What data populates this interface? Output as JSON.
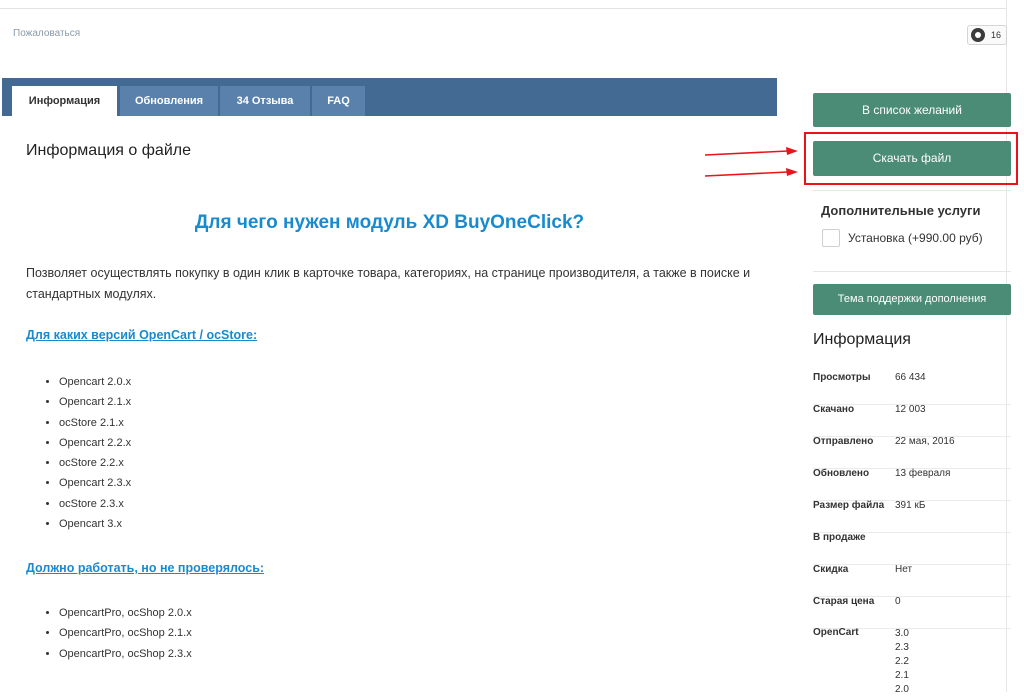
{
  "header": {
    "report": "Пожаловаться",
    "reaction_count": "16"
  },
  "tabs": [
    {
      "label": "Информация"
    },
    {
      "label": "Обновления"
    },
    {
      "label": "34 Отзыва"
    },
    {
      "label": "FAQ"
    }
  ],
  "content": {
    "section_title": "Информация о файле",
    "heading": "Для чего нужен модуль XD BuyOneClick?",
    "description": "Позволяет осуществлять покупку в один клик в карточке товара, категориях, на странице производителя, а также в поиске и стандартных модулях.",
    "versions_link": "Для каких версий OpenCart / ocStore:",
    "versions": [
      "Opencart 2.0.x",
      "Opencart 2.1.x",
      "ocStore 2.1.x",
      "Opencart 2.2.x",
      "ocStore 2.2.x",
      "Opencart 2.3.x",
      "ocStore 2.3.x",
      "Opencart 3.x"
    ],
    "untested_link": "Должно работать, но не проверялось:",
    "untested": [
      "OpencartPro, ocShop 2.0.x",
      "OpencartPro, ocShop 2.1.x",
      "OpencartPro, ocShop 2.3.x"
    ]
  },
  "sidebar": {
    "wishlist_button": "В список желаний",
    "download_button": "Скачать файл",
    "addons_title": "Дополнительные услуги",
    "install_option": "Установка (+990.00 руб)",
    "support_button": "Тема поддержки дополнения",
    "info_title": "Информация",
    "info": [
      {
        "key": "Просмотры",
        "value": "66 434"
      },
      {
        "key": "Скачано",
        "value": "12 003"
      },
      {
        "key": "Отправлено",
        "value": "22 мая, 2016"
      },
      {
        "key": "Обновлено",
        "value": "13 февраля"
      },
      {
        "key": "Размер файла",
        "value": "391 кБ"
      },
      {
        "key": "В продаже",
        "value": ""
      },
      {
        "key": "Скидка",
        "value": "Нет"
      },
      {
        "key": "Старая цена",
        "value": "0"
      },
      {
        "key": "OpenCart",
        "values": [
          "3.0",
          "2.3",
          "2.2",
          "2.1",
          "2.0"
        ]
      }
    ]
  },
  "colors": {
    "accent": "#1a8ace",
    "tabbar": "#436a93",
    "button": "#4a8c75",
    "highlight": "#e8141a"
  }
}
